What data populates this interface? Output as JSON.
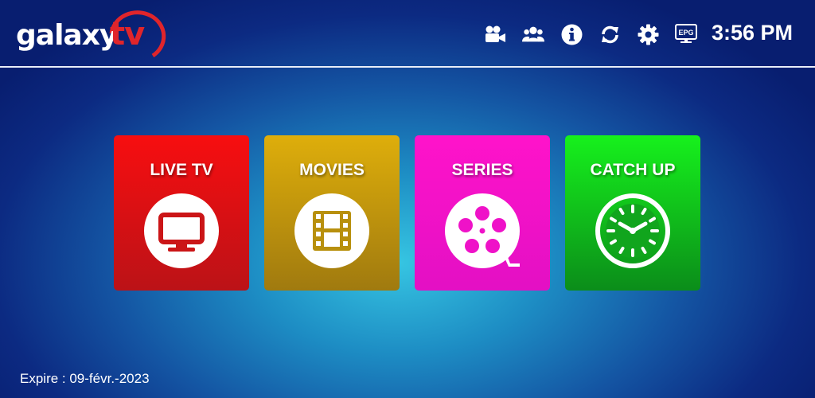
{
  "app": {
    "logo_main": "galaxy",
    "logo_accent": "tv"
  },
  "header": {
    "icons": [
      "movie-camera-icon",
      "users-icon",
      "info-icon",
      "refresh-icon",
      "settings-icon",
      "epg-icon"
    ],
    "epg_label": "EPG",
    "time": "3:56 PM"
  },
  "tiles": [
    {
      "label": "LIVE TV",
      "icon": "tv-icon",
      "color": "#f70e10"
    },
    {
      "label": "MOVIES",
      "icon": "film-strip-icon",
      "color": "#deae0b"
    },
    {
      "label": "SERIES",
      "icon": "film-reel-icon",
      "color": "#ff13ca"
    },
    {
      "label": "CATCH UP",
      "icon": "clock-icon",
      "color": "#16f11c"
    }
  ],
  "footer": {
    "expire": "Expire : 09-févr.-2023"
  }
}
